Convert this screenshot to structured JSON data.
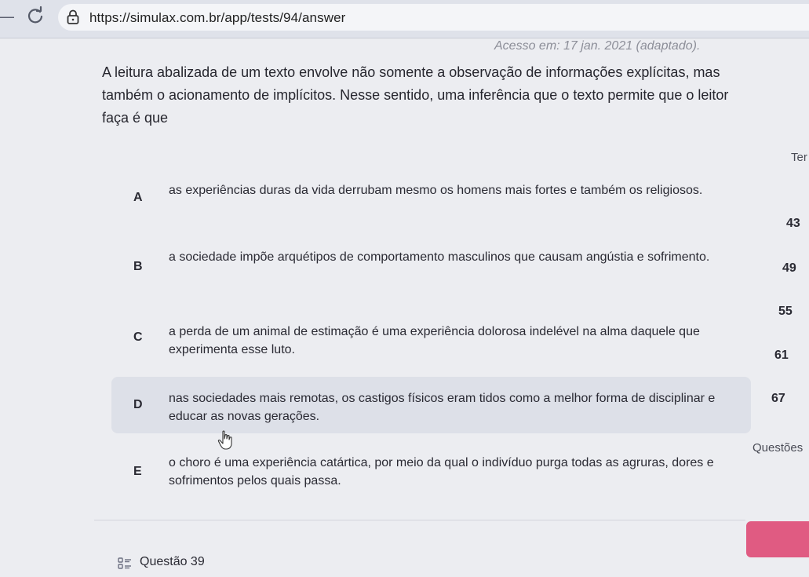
{
  "browser": {
    "url": "https://simulax.com.br/app/tests/94/answer"
  },
  "source_text": "Acesso em: 17 jan. 2021 (adaptado).",
  "question": {
    "stem": "A leitura abalizada de um texto envolve não somente a observação de informações explícitas, mas também o acionamento de implícitos. Nesse sentido, uma inferência que o texto permite que o leitor faça é que",
    "options": [
      {
        "letter": "A",
        "text": "as experiências duras da vida derrubam mesmo os homens mais fortes e também os religiosos."
      },
      {
        "letter": "B",
        "text": "a sociedade impõe arquétipos de comportamento masculinos que causam angústia e sofrimento."
      },
      {
        "letter": "C",
        "text": "a perda de um animal de estimação é uma experiência dolorosa indelével na alma daquele que experimenta esse luto."
      },
      {
        "letter": "D",
        "text": "nas sociedades mais remotas, os castigos físicos eram tidos como a melhor forma de disciplinar e educar as novas gerações."
      },
      {
        "letter": "E",
        "text": "o choro é uma experiência catártica, por meio da qual o indivíduo purga todas as agruras, dores e sofrimentos pelos quais passa."
      }
    ],
    "selected": "D"
  },
  "sidebar": {
    "label_top": "Ter",
    "numbers": [
      "43",
      "49",
      "55",
      "61",
      "67"
    ],
    "label_bottom": "Questões"
  },
  "footer": {
    "question_label": "Questão 39"
  },
  "colors": {
    "accent": "#e05b82",
    "selected_bg": "#dde0e8"
  }
}
